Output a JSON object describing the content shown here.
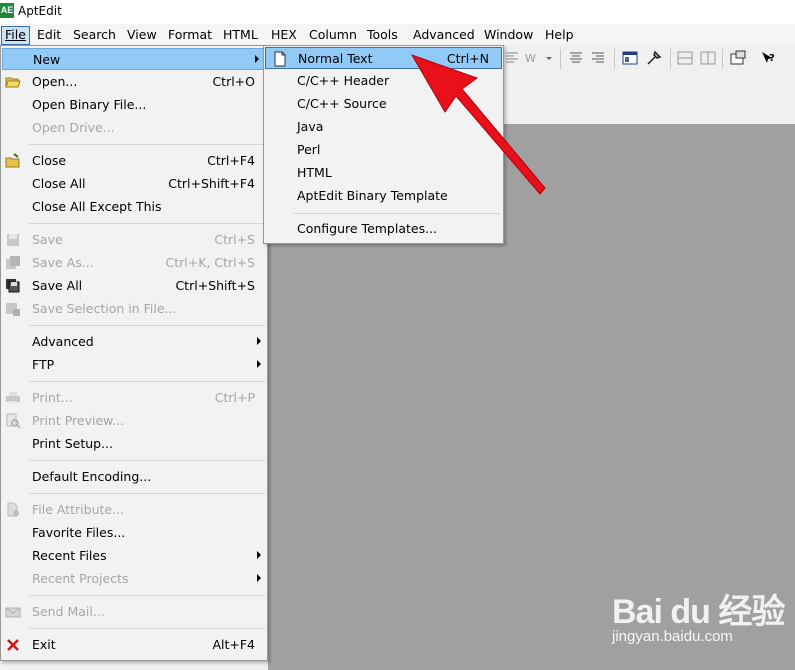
{
  "window": {
    "title": "AptEdit",
    "logo_text": "AE"
  },
  "menubar": [
    {
      "label": "File",
      "active": true
    },
    {
      "label": "Edit"
    },
    {
      "label": "Search"
    },
    {
      "label": "View"
    },
    {
      "label": "Format"
    },
    {
      "label": "HTML"
    },
    {
      "label": "HEX"
    },
    {
      "label": "Column"
    },
    {
      "label": "Tools"
    },
    {
      "label": "Advanced"
    },
    {
      "label": "Window"
    },
    {
      "label": "Help"
    }
  ],
  "file_menu": {
    "new": {
      "label": "New"
    },
    "open": {
      "label": "Open...",
      "shortcut": "Ctrl+O"
    },
    "open_binary": {
      "label": "Open Binary File..."
    },
    "open_drive": {
      "label": "Open Drive..."
    },
    "close": {
      "label": "Close",
      "shortcut": "Ctrl+F4"
    },
    "close_all": {
      "label": "Close All",
      "shortcut": "Ctrl+Shift+F4"
    },
    "close_all_except": {
      "label": "Close All Except This"
    },
    "save": {
      "label": "Save",
      "shortcut": "Ctrl+S"
    },
    "save_as": {
      "label": "Save As...",
      "shortcut": "Ctrl+K, Ctrl+S"
    },
    "save_all": {
      "label": "Save All",
      "shortcut": "Ctrl+Shift+S"
    },
    "save_selection": {
      "label": "Save Selection in File..."
    },
    "advanced": {
      "label": "Advanced"
    },
    "ftp": {
      "label": "FTP"
    },
    "print": {
      "label": "Print...",
      "shortcut": "Ctrl+P"
    },
    "print_preview": {
      "label": "Print Preview..."
    },
    "print_setup": {
      "label": "Print Setup..."
    },
    "default_encoding": {
      "label": "Default Encoding..."
    },
    "file_attribute": {
      "label": "File Attribute..."
    },
    "favorite_files": {
      "label": "Favorite Files..."
    },
    "recent_files": {
      "label": "Recent Files"
    },
    "recent_projects": {
      "label": "Recent Projects"
    },
    "send_mail": {
      "label": "Send Mail..."
    },
    "exit": {
      "label": "Exit",
      "shortcut": "Alt+F4"
    }
  },
  "new_submenu": {
    "normal_text": {
      "label": "Normal Text",
      "shortcut": "Ctrl+N"
    },
    "cpp_header": {
      "label": "C/C++ Header"
    },
    "cpp_source": {
      "label": "C/C++ Source"
    },
    "java": {
      "label": "Java"
    },
    "perl": {
      "label": "Perl"
    },
    "html": {
      "label": "HTML"
    },
    "binary_template": {
      "label": "AptEdit Binary Template"
    },
    "configure_templates": {
      "label": "Configure Templates..."
    }
  },
  "watermark": {
    "brand": "Bai du 经验",
    "url": "jingyan.baidu.com"
  },
  "colors": {
    "highlight": "#91c9f7",
    "workspace": "#a0a0a0",
    "arrow": "#e8101a",
    "disabled_text": "#a6a6a6"
  }
}
